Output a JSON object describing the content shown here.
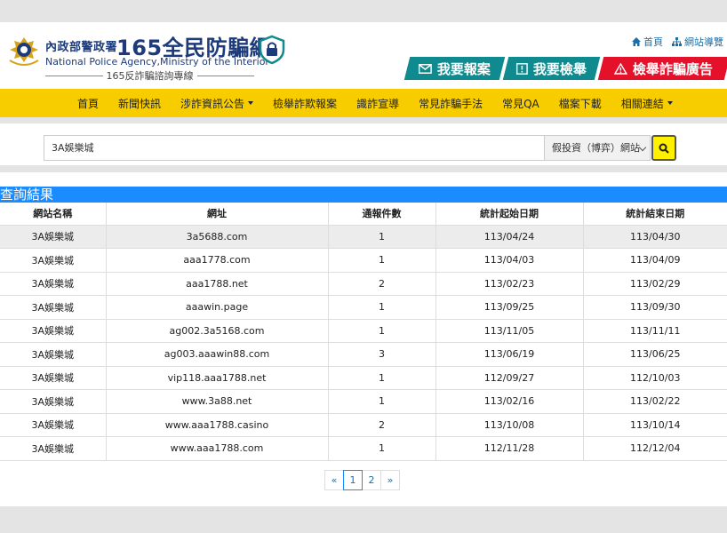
{
  "header": {
    "agency_cn": "內政部警政署",
    "site_name": "165全民防騙網",
    "agency_en": "National Police Agency,Ministry of the Interior",
    "hotline": "165反詐騙諮詢專線",
    "util_links": [
      {
        "label": "首頁",
        "icon": "home-icon"
      },
      {
        "label": "網站導覽",
        "icon": "sitemap-icon"
      }
    ],
    "cta": [
      {
        "label": "我要報案",
        "icon": "envelope-icon",
        "color": "#0f8a8e"
      },
      {
        "label": "我要檢舉",
        "icon": "exclamation-box-icon",
        "color": "#0f8a8e"
      },
      {
        "label": "檢舉詐騙廣告",
        "icon": "warning-triangle-icon",
        "color": "#e5102a"
      }
    ]
  },
  "nav": {
    "items": [
      {
        "label": "首頁",
        "dropdown": false
      },
      {
        "label": "新聞快訊",
        "dropdown": false
      },
      {
        "label": "涉詐資訊公告",
        "dropdown": true
      },
      {
        "label": "檢舉詐欺報案",
        "dropdown": false
      },
      {
        "label": "識詐宣導",
        "dropdown": false
      },
      {
        "label": "常見詐騙手法",
        "dropdown": false
      },
      {
        "label": "常見QA",
        "dropdown": false
      },
      {
        "label": "檔案下載",
        "dropdown": false
      },
      {
        "label": "相關連結",
        "dropdown": true
      }
    ],
    "bg_color": "#f7cd00"
  },
  "search": {
    "value": "3A娛樂城",
    "category": "假投資（博弈）網站"
  },
  "results": {
    "title": "查詢結果",
    "columns": [
      "網站名稱",
      "網址",
      "通報件數",
      "統計起始日期",
      "統計結束日期"
    ],
    "rows": [
      [
        "3A娛樂城",
        "3a5688.com",
        "1",
        "113/04/24",
        "113/04/30"
      ],
      [
        "3A娛樂城",
        "aaa1778.com",
        "1",
        "113/04/03",
        "113/04/09"
      ],
      [
        "3A娛樂城",
        "aaa1788.net",
        "2",
        "113/02/23",
        "113/02/29"
      ],
      [
        "3A娛樂城",
        "aaawin.page",
        "1",
        "113/09/25",
        "113/09/30"
      ],
      [
        "3A娛樂城",
        "ag002.3a5168.com",
        "1",
        "113/11/05",
        "113/11/11"
      ],
      [
        "3A娛樂城",
        "ag003.aaawin88.com",
        "3",
        "113/06/19",
        "113/06/25"
      ],
      [
        "3A娛樂城",
        "vip118.aaa1788.net",
        "1",
        "112/09/27",
        "112/10/03"
      ],
      [
        "3A娛樂城",
        "www.3a88.net",
        "1",
        "113/02/16",
        "113/02/22"
      ],
      [
        "3A娛樂城",
        "www.aaa1788.casino",
        "2",
        "113/10/08",
        "113/10/14"
      ],
      [
        "3A娛樂城",
        "www.aaa1788.com",
        "1",
        "112/11/28",
        "112/12/04"
      ]
    ]
  },
  "pagination": {
    "prev": "«",
    "pages": [
      "1",
      "2"
    ],
    "current": "1",
    "next": "»"
  }
}
